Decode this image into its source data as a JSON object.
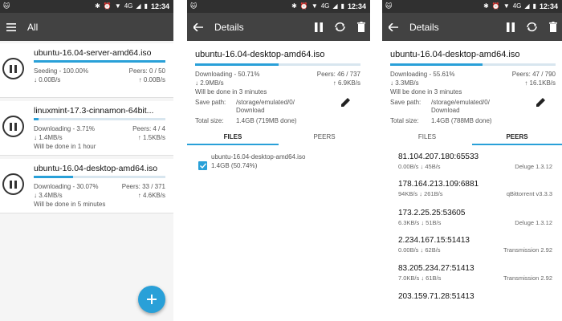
{
  "status": {
    "network": "4G",
    "time": "12:34"
  },
  "list_screen": {
    "title": "All",
    "torrents": [
      {
        "name": "ubuntu-16.04-server-amd64.iso",
        "progress": 1.0,
        "status": "Seeding - 100.00%",
        "peers": "Peers: 0 / 50",
        "down": "↓ 0.00B/s",
        "up": "↑ 0.00B/s",
        "eta": ""
      },
      {
        "name": "linuxmint-17.3-cinnamon-64bit...",
        "progress": 0.0371,
        "status": "Downloading - 3.71%",
        "peers": "Peers: 4 / 4",
        "down": "↓ 1.4MB/s",
        "up": "↑ 1.5KB/s",
        "eta": "Will be done in 1 hour"
      },
      {
        "name": "ubuntu-16.04-desktop-amd64.iso",
        "progress": 0.3007,
        "status": "Downloading - 30.07%",
        "peers": "Peers: 33 / 371",
        "down": "↓ 3.4MB/s",
        "up": "↑ 4.6KB/s",
        "eta": "Will be done in 5 minutes"
      }
    ]
  },
  "details_files": {
    "title": "Details",
    "name": "ubuntu-16.04-desktop-amd64.iso",
    "progress": 0.5071,
    "status": "Downloading - 50.71%",
    "peers": "Peers: 46 / 737",
    "down": "↓ 2.9MB/s",
    "up": "↑ 6.9KB/s",
    "eta": "Will be done in 3 minutes",
    "save_path_label": "Save path:",
    "save_path_line1": "/storage/emulated/0/",
    "save_path_line2": "Download",
    "total_size_label": "Total size:",
    "total_size": "1.4GB (719MB done)",
    "tab_files": "FILES",
    "tab_peers": "PEERS",
    "file_name": "ubuntu-16.04-desktop-amd64.iso",
    "file_size": "1.4GB (50.74%)"
  },
  "details_peers": {
    "title": "Details",
    "name": "ubuntu-16.04-desktop-amd64.iso",
    "progress": 0.5561,
    "status": "Downloading - 55.61%",
    "peers": "Peers: 47 / 790",
    "down": "↓ 3.3MB/s",
    "up": "↑ 16.1KB/s",
    "eta": "Will be done in 3 minutes",
    "save_path_label": "Save path:",
    "save_path_line1": "/storage/emulated/0/",
    "save_path_line2": "Download",
    "total_size_label": "Total size:",
    "total_size": "1.4GB (788MB done)",
    "tab_files": "FILES",
    "tab_peers": "PEERS",
    "peer_list": [
      {
        "ip": "81.104.207.180:65533",
        "speed": "0.00B/s ↓ 45B/s",
        "client": "Deluge 1.3.12"
      },
      {
        "ip": "178.164.213.109:6881",
        "speed": "94KB/s ↓ 261B/s",
        "client": "qBittorrent v3.3.3"
      },
      {
        "ip": "173.2.25.25:53605",
        "speed": "6.3KB/s ↓ 51B/s",
        "client": "Deluge 1.3.12"
      },
      {
        "ip": "2.234.167.15:51413",
        "speed": "0.00B/s ↓ 62B/s",
        "client": "Transmission 2.92"
      },
      {
        "ip": "83.205.234.27:51413",
        "speed": "7.0KB/s ↓ 61B/s",
        "client": "Transmission 2.92"
      },
      {
        "ip": "203.159.71.28:51413",
        "speed": "",
        "client": ""
      }
    ]
  },
  "colors": {
    "accent": "#29a0d8",
    "appbar": "#424242",
    "statusbar": "#303030"
  }
}
